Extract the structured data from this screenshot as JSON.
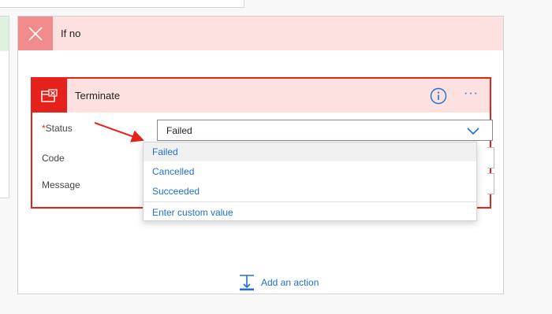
{
  "branch": {
    "title": "If no",
    "icon": "close-icon",
    "header_bg": "#fde0e0",
    "icon_bg": "#f28b8b"
  },
  "action": {
    "title": "Terminate",
    "icon": "terminate-icon",
    "accent": "#e5211c",
    "info_icon": "info-icon",
    "more_label": "···"
  },
  "fields": {
    "status": {
      "required_mark": "*",
      "label": "Status",
      "value": "Failed"
    },
    "code": {
      "label": "Code"
    },
    "message": {
      "label": "Message"
    }
  },
  "dropdown": {
    "options": [
      "Failed",
      "Cancelled",
      "Succeeded"
    ],
    "selected": "Failed",
    "custom": "Enter custom value"
  },
  "add_action": {
    "label": "Add an action",
    "icon": "add-step-icon"
  },
  "annotation": {
    "icon": "red-arrow",
    "color": "#e5211c"
  }
}
